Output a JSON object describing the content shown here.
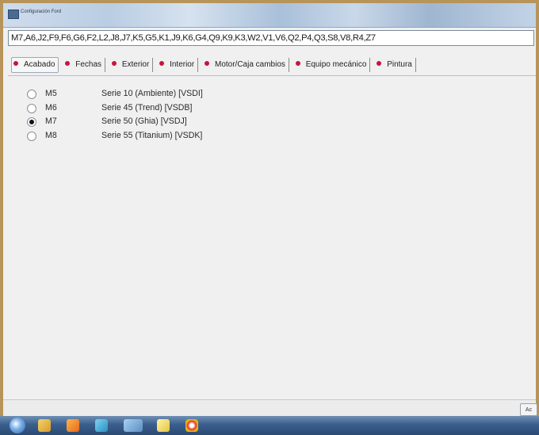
{
  "window": {
    "title": "Configuración Ford"
  },
  "config_code": "M7,A6,J2,F9,F6,G6,F2,L2,J8,J7,K5,G5,K1,J9,K6,G4,Q9,K9,K3,W2,V1,V6,Q2,P4,Q3,S8,V8,R4,Z7",
  "tabs": [
    {
      "label": "Acabado",
      "active": true
    },
    {
      "label": "Fechas"
    },
    {
      "label": "Exterior"
    },
    {
      "label": "Interior"
    },
    {
      "label": "Motor/Caja cambios"
    },
    {
      "label": "Equipo mecánico"
    },
    {
      "label": "Pintura"
    }
  ],
  "options": [
    {
      "code": "M5",
      "description": "Serie 10 (Ambiente)  [VSDI]",
      "selected": false
    },
    {
      "code": "M6",
      "description": "Serie 45 (Trend)  [VSDB]",
      "selected": false
    },
    {
      "code": "M7",
      "description": "Serie 50 (Ghia)  [VSDJ]",
      "selected": true
    },
    {
      "code": "M8",
      "description": "Serie 55 (Titanium)  [VSDK]",
      "selected": false
    }
  ],
  "footer": {
    "button_label": "Ac"
  },
  "colors": {
    "tab_dot": "#c8143c",
    "outer_border": "#b7945a",
    "window_background": "#f0f0f0"
  },
  "taskbar": {
    "icons": [
      "start-orb-icon",
      "explorer-icon",
      "media-icon",
      "network-icon",
      "folder-icon",
      "note-icon",
      "chrome-icon"
    ]
  }
}
